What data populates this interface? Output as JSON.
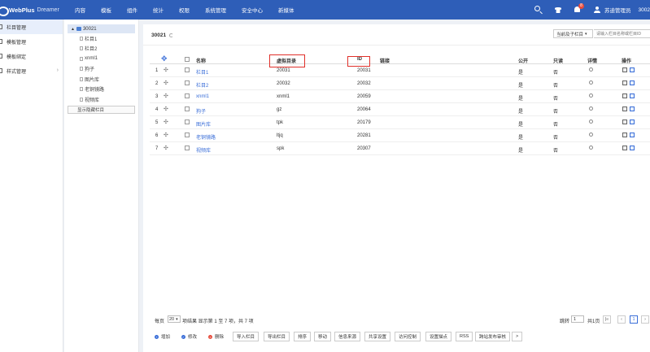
{
  "brand": {
    "name": "WebPlus",
    "sub": "Dreamer"
  },
  "nav": [
    "内容",
    "模板",
    "组件",
    "统计",
    "权限",
    "系统管理",
    "安全中心",
    "新媒体"
  ],
  "header": {
    "notif_count": "8",
    "user": "苏迪管理员",
    "site_id": "3002"
  },
  "sidebar": {
    "items": [
      {
        "label": "栏目管理"
      },
      {
        "label": "模板管理"
      },
      {
        "label": "模板绑定"
      },
      {
        "label": "样式管理",
        "arrow": "›"
      }
    ]
  },
  "tree": {
    "toggle": "▲",
    "root": "30021",
    "nodes": [
      "栏目1",
      "栏目2",
      "xnml1",
      "狗子",
      "图片库",
      "老铜镜路",
      "视频库"
    ],
    "show_hidden": "显示隐藏栏目"
  },
  "main": {
    "title": "30021",
    "scope": "当前及子栏目",
    "search_placeholder": "请输入栏目名称或栏目ID"
  },
  "table": {
    "move_icon": "✥",
    "drag_glyph": "✣",
    "headers": {
      "name": "名称",
      "vdir": "虚拟目录",
      "id": "ID",
      "link": "链接",
      "public": "公开",
      "readonly": "只读",
      "detail": "详情",
      "ops": "操作"
    },
    "rows": [
      {
        "num": "1",
        "name": "栏目1",
        "vdir": "20031",
        "id": "20031",
        "public": "是",
        "readonly": "否"
      },
      {
        "num": "2",
        "name": "栏目2",
        "vdir": "20032",
        "id": "20032",
        "public": "是",
        "readonly": "否"
      },
      {
        "num": "3",
        "name": "xnml1",
        "vdir": "xnml1",
        "id": "20059",
        "public": "是",
        "readonly": "否"
      },
      {
        "num": "4",
        "name": "狗子",
        "vdir": "gz",
        "id": "20064",
        "public": "是",
        "readonly": "否"
      },
      {
        "num": "5",
        "name": "图片库",
        "vdir": "tpk",
        "id": "20179",
        "public": "是",
        "readonly": "否"
      },
      {
        "num": "6",
        "name": "老铜镜路",
        "vdir": "ltjq",
        "id": "20281",
        "public": "是",
        "readonly": "否"
      },
      {
        "num": "7",
        "name": "视频库",
        "vdir": "spk",
        "id": "20307",
        "public": "是",
        "readonly": "否"
      }
    ]
  },
  "pager": {
    "per_page_label": "每页",
    "per_page": "20",
    "summary": "项结果 显示第 1 至 7 项，共 7 项",
    "jump_label": "跳转",
    "jump_value": "1",
    "total_pages": "共1页",
    "first": "|«",
    "prev": "‹",
    "current": "1",
    "next": "›"
  },
  "toolbar": {
    "add": "增加",
    "edit": "修改",
    "delete": "删除",
    "import": "导入栏目",
    "export": "导出栏目",
    "sort": "排序",
    "move": "移动",
    "source": "信息来源",
    "share": "共享设置",
    "access": "访问控制",
    "points": "设置描点",
    "rss": "RSS",
    "cross_publish": "跨站发布审核",
    "more": ">"
  },
  "colors": {
    "topbar": "#2e5eb8",
    "accent": "#3a6ed8",
    "highlight": "#e0302a",
    "danger": "#e74c3c"
  }
}
